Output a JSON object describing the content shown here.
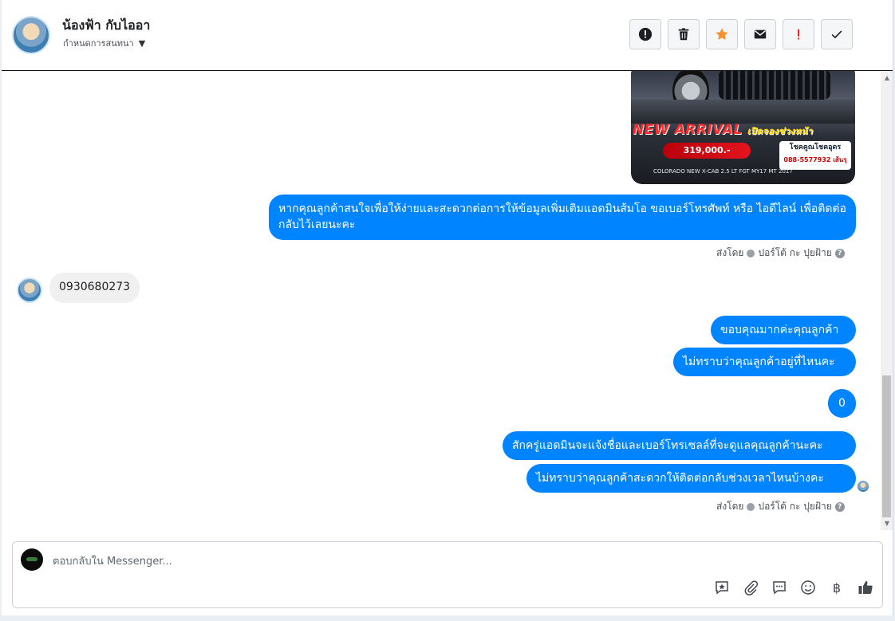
{
  "header": {
    "contact_name": "น้องฟ้า กับไออา",
    "assign_label": "กำหนดการสนทนา",
    "actions": [
      {
        "name": "report-spam-button",
        "icon": "alert-circle-icon",
        "color": "#1c1e21"
      },
      {
        "name": "delete-button",
        "icon": "trash-icon",
        "color": "#1c1e21"
      },
      {
        "name": "star-button",
        "icon": "star-icon",
        "color": "#f5922f"
      },
      {
        "name": "mark-unread-button",
        "icon": "envelope-icon",
        "color": "#1c1e21"
      },
      {
        "name": "flag-important-button",
        "icon": "exclamation-icon",
        "color": "#e02020"
      },
      {
        "name": "mark-done-button",
        "icon": "checkmark-icon",
        "color": "#1c1e21"
      }
    ]
  },
  "conversation": {
    "image_message": {
      "banner": "NEW ARRIVAL",
      "banner_sub": "เปิดจองช่วงหน้า",
      "price": "319,000.-",
      "dealer": "โชคคูณโชคอุดร",
      "dealer_phone": "088-5577932 เส้นรุ",
      "model": "COLORADO NEW X-CAB 2.5 LT FGT MY17 MT 2017"
    },
    "msg_out_1": "หากคุณลูกค้าสนใจเพื่อให้ง่ายและสะดวกต่อการให้ข้อมูลเพิ่มเติมแอดมินส้มโอ ขอเบอร์โทรศัพท์ หรือ ไอดีไลน์ เพื่อติดต่อกลับไว้เลยนะคะ",
    "sent_by_label": "ส่งโดย",
    "sent_by_name": "ปอร์โต้ กะ ปุยฝ้าย",
    "msg_in_1": "0930680273",
    "msg_out_2": "ขอบคุณมากค่ะคุณลูกค้า",
    "msg_out_3": "ไม่ทราบว่าคุณลูกค้าอยู่ที่ไหนคะ",
    "msg_out_4": "0",
    "msg_out_5": "สักครู่แอดมินจะแจ้งชื่อและเบอร์โทรเซลล์ที่จะดูแลคุณลูกค้านะคะ",
    "msg_out_6": "ไม่ทราบว่าคุณลูกค้าสะดวกให้ติดต่อกลับช่วงเวลาไหนบ้างคะ",
    "help_glyph": "?"
  },
  "composer": {
    "placeholder": "ตอบกลับใน Messenger...",
    "currency_glyph": "฿",
    "tools": [
      "saved-reply-icon",
      "paperclip-icon",
      "chat-bubble-icon",
      "emoji-icon",
      "baht-icon",
      "thumbs-up-icon"
    ]
  },
  "colors": {
    "outgoing_bubble": "#0084ff",
    "incoming_bubble": "#f1f0f0",
    "star": "#f5922f",
    "flag": "#e02020"
  }
}
